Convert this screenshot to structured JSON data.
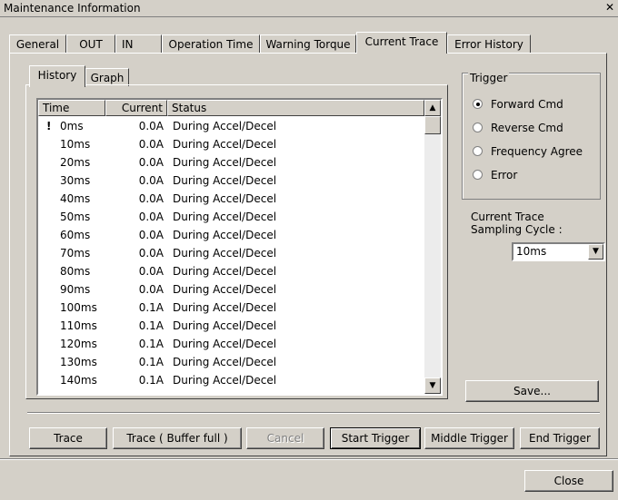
{
  "window": {
    "title": "Maintenance Information",
    "close_glyph": "✕"
  },
  "outer_tabs": [
    "General",
    "OUT",
    "IN",
    "Operation Time",
    "Warning Torque",
    "Current Trace",
    "Error History"
  ],
  "inner_tabs": [
    "History",
    "Graph"
  ],
  "table": {
    "columns": [
      "Time",
      "Current",
      "Status"
    ],
    "rows": [
      {
        "time": "0ms",
        "current": "0.0A",
        "status": "During Accel/Decel"
      },
      {
        "time": "10ms",
        "current": "0.0A",
        "status": "During Accel/Decel"
      },
      {
        "time": "20ms",
        "current": "0.0A",
        "status": "During Accel/Decel"
      },
      {
        "time": "30ms",
        "current": "0.0A",
        "status": "During Accel/Decel"
      },
      {
        "time": "40ms",
        "current": "0.0A",
        "status": "During Accel/Decel"
      },
      {
        "time": "50ms",
        "current": "0.0A",
        "status": "During Accel/Decel"
      },
      {
        "time": "60ms",
        "current": "0.0A",
        "status": "During Accel/Decel"
      },
      {
        "time": "70ms",
        "current": "0.0A",
        "status": "During Accel/Decel"
      },
      {
        "time": "80ms",
        "current": "0.0A",
        "status": "During Accel/Decel"
      },
      {
        "time": "90ms",
        "current": "0.0A",
        "status": "During Accel/Decel"
      },
      {
        "time": "100ms",
        "current": "0.1A",
        "status": "During Accel/Decel"
      },
      {
        "time": "110ms",
        "current": "0.1A",
        "status": "During Accel/Decel"
      },
      {
        "time": "120ms",
        "current": "0.1A",
        "status": "During Accel/Decel"
      },
      {
        "time": "130ms",
        "current": "0.1A",
        "status": "During Accel/Decel"
      },
      {
        "time": "140ms",
        "current": "0.1A",
        "status": "During Accel/Decel"
      }
    ],
    "trigger_mark": "!"
  },
  "trigger": {
    "title": "Trigger",
    "options": [
      "Forward Cmd",
      "Reverse Cmd",
      "Frequency Agree",
      "Error"
    ],
    "selected": "Forward Cmd"
  },
  "sampling": {
    "label_line1": "Current Trace",
    "label_line2": "Sampling Cycle :",
    "value": "10ms"
  },
  "buttons": {
    "save": "Save...",
    "trace": "Trace",
    "trace_buffer_full": "Trace ( Buffer full )",
    "cancel": "Cancel",
    "start_trigger": "Start Trigger",
    "middle_trigger": "Middle Trigger",
    "end_trigger": "End Trigger",
    "close": "Close"
  }
}
